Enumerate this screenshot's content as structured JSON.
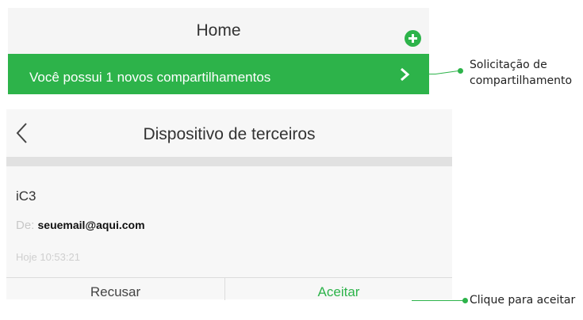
{
  "home": {
    "title": "Home",
    "add_icon": "plus-circle-icon",
    "banner_text": "Você possui 1 novos compartilhamentos",
    "banner_icon": "chevron-right-icon"
  },
  "annotations": {
    "share_request_line1": "Solicitação de",
    "share_request_line2": "compartilhamento",
    "accept_hint": "Clique para aceitar"
  },
  "panel": {
    "title": "Dispositivo de terceiros",
    "back_icon": "chevron-left-icon",
    "device_name": "iC3",
    "from_label": "De: ",
    "from_email": "seuemail@aqui.com",
    "timestamp": "Hoje 10:53:21",
    "decline_label": "Recusar",
    "accept_label": "Aceitar"
  },
  "colors": {
    "accent": "#2db34a",
    "header_bg": "#f5f5f5",
    "divider": "#e1e1e1"
  }
}
